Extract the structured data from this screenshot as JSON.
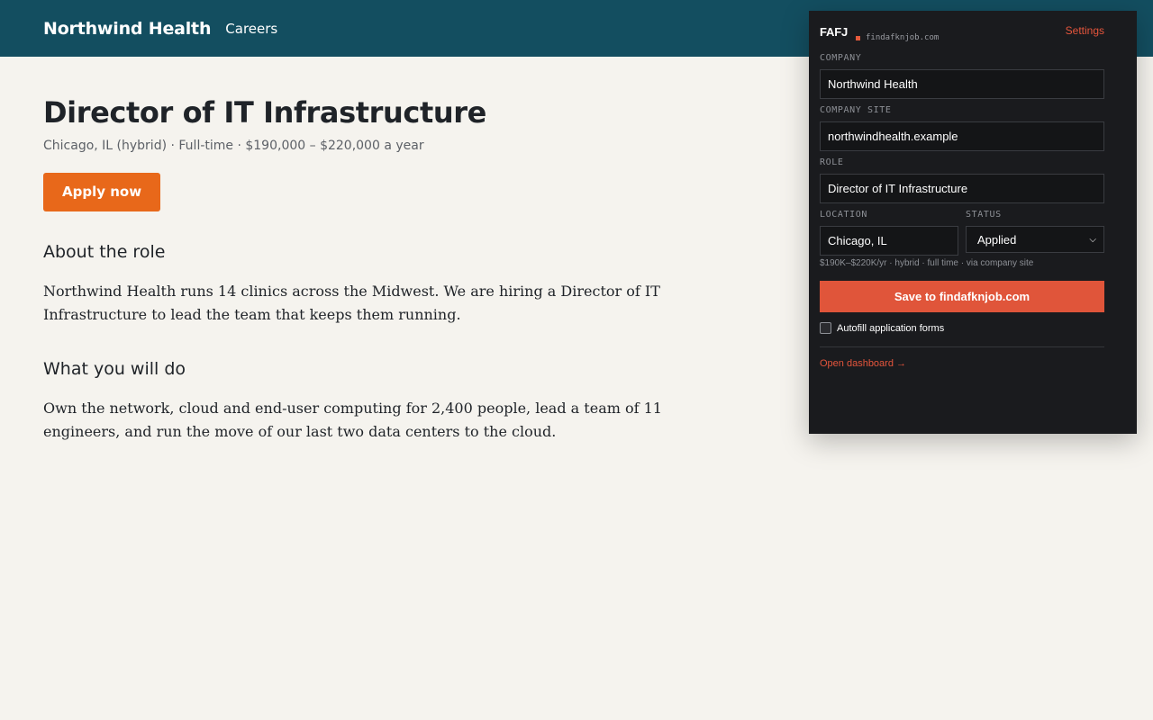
{
  "header": {
    "brand": "Northwind Health",
    "nav_careers": "Careers"
  },
  "job": {
    "title": "Director of IT Infrastructure",
    "meta": "Chicago, IL (hybrid) · Full-time · $190,000 – $220,000 a year",
    "apply_label": "Apply now",
    "sections": [
      {
        "heading": "About the role",
        "body": "Northwind Health runs 14 clinics across the Midwest. We are hiring a Director of IT Infrastructure to lead the team that keeps them running."
      },
      {
        "heading": "What you will do",
        "body": "Own the network, cloud and end-user computing for 2,400 people, lead a team of 11 engineers, and run the move of our last two data centers to the cloud."
      }
    ]
  },
  "extension": {
    "logo": "FAFJ",
    "domain": "findafknjob.com",
    "settings_label": "Settings",
    "company_label": "COMPANY",
    "company_value": "Northwind Health",
    "site_label": "COMPANY SITE",
    "site_value": "northwindhealth.example",
    "role_label": "ROLE",
    "role_value": "Director of IT Infrastructure",
    "location_label": "LOCATION",
    "location_value": "Chicago, IL",
    "status_label": "STATUS",
    "status_value": "Applied",
    "summary": "$190K–$220K/yr · hybrid · full time · via company site",
    "save_label": "Save to findafknjob.com",
    "autofill_label": "Autofill application forms",
    "autofill_checked": false,
    "dashboard_link": "Open dashboard →"
  },
  "colors": {
    "header_bg": "#134e60",
    "apply_button": "#e8681a",
    "panel_bg": "#1a1b1e",
    "accent": "#e0553a"
  },
  "icons": {
    "status_select": "chevron-down-icon",
    "logo_mark": "square-dot-icon"
  }
}
